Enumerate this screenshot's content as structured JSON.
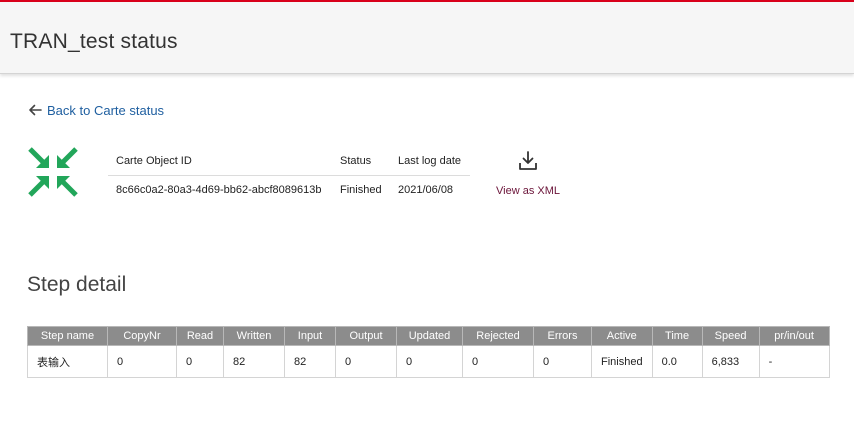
{
  "header": {
    "title": "TRAN_test status"
  },
  "nav": {
    "back_label": "Back to Carte status"
  },
  "carte_info": {
    "columns": [
      "Carte Object ID",
      "Status",
      "Last log date"
    ],
    "object_id": "8c66c0a2-80a3-4d69-bb62-abcf8089613b",
    "status": "Finished",
    "last_log_date": "2021/06/08"
  },
  "xml": {
    "label": "View as XML"
  },
  "step_detail": {
    "title": "Step detail",
    "columns": [
      "Step name",
      "CopyNr",
      "Read",
      "Written",
      "Input",
      "Output",
      "Updated",
      "Rejected",
      "Errors",
      "Active",
      "Time",
      "Speed",
      "pr/in/out"
    ],
    "rows": [
      [
        "表输入",
        "0",
        "0",
        "82",
        "82",
        "0",
        "0",
        "0",
        "0",
        "Finished",
        "0.0",
        "6,833",
        "-"
      ]
    ]
  },
  "colors": {
    "accent_red": "#d9001b",
    "link_blue": "#1f5fa0",
    "status_green": "#168a16",
    "icon_green": "#22a65a",
    "xml_link": "#6b1439",
    "table_header_bg": "#8c8c8c"
  },
  "icons": [
    "arrow-left-icon",
    "compress-arrows-icon",
    "download-icon"
  ]
}
